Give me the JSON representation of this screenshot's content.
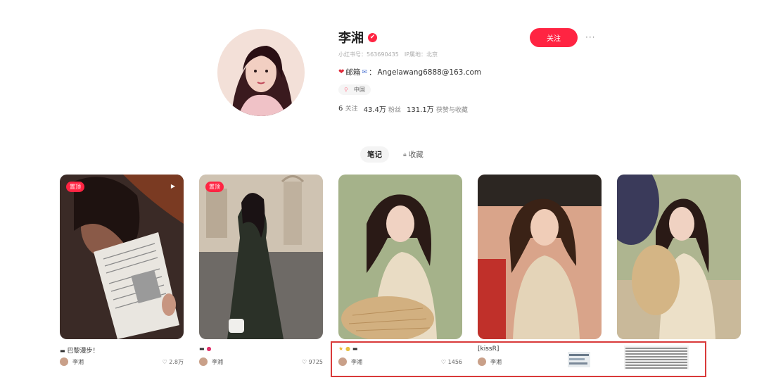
{
  "profile": {
    "name": "李湘",
    "verified_mark": "✔",
    "redbook_id": "小红书号：563690435",
    "ip_location": "IP属地：北京",
    "email_label": "邮箱",
    "email": "Angelawang6888@163.com",
    "location_tag": "中国",
    "following_count": "6",
    "following_label": "关注",
    "followers_count": "43.4万",
    "followers_label": "粉丝",
    "likes_count": "131.1万",
    "likes_label": "获赞与收藏",
    "follow_button": "关注",
    "more_icon": "more-dots-icon"
  },
  "tabs": [
    {
      "label": "笔记",
      "active": true
    },
    {
      "label": "收藏",
      "active": false,
      "icon": "lock-icon"
    }
  ],
  "notes": [
    {
      "pinned_label": "置顶",
      "title": "巴黎漫步！",
      "author": "李湘",
      "likes": "2.8万",
      "video": true
    },
    {
      "pinned_label": "置顶",
      "title": "",
      "author": "李湘",
      "likes": "9725",
      "video": false
    },
    {
      "pinned_label": "",
      "title": "",
      "author": "李湘",
      "likes": "1456",
      "video": false
    },
    {
      "pinned_label": "",
      "title": "[kissR]",
      "author": "李湘",
      "likes": "",
      "video": false
    },
    {
      "pinned_label": "",
      "title": "",
      "author": "",
      "likes": "",
      "video": false
    }
  ],
  "colors": {
    "accent": "#ff2442",
    "highlight_border": "#d93a3a"
  }
}
